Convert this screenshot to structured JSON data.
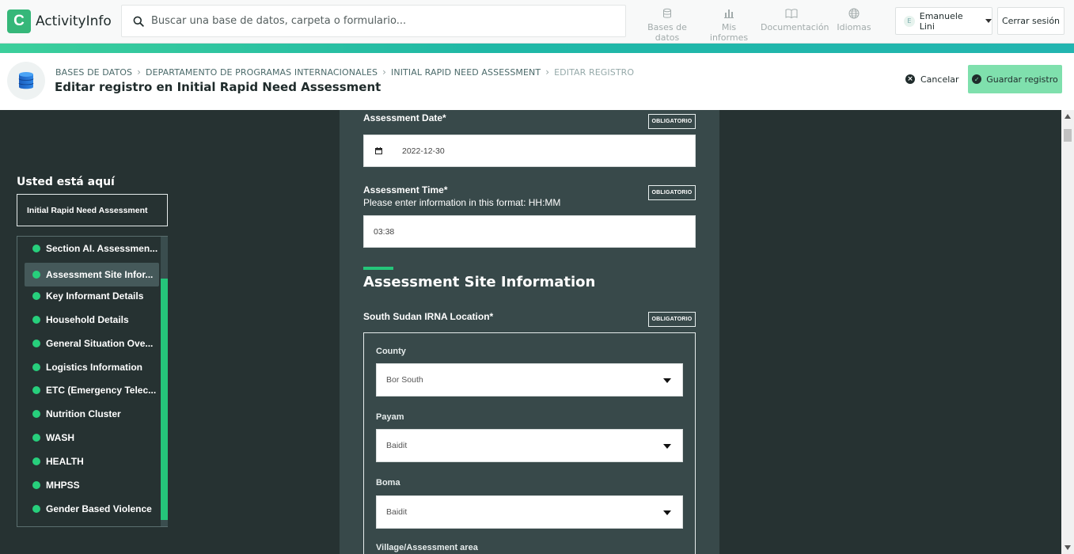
{
  "topbar": {
    "brand": {
      "logo_glyph": "C",
      "name": "ActivityInfo"
    },
    "search": {
      "placeholder": "Buscar una base de datos, carpeta o formulario..."
    },
    "nav": [
      {
        "label": "Bases de datos",
        "icon": "database-icon"
      },
      {
        "label": "Mis informes",
        "icon": "bar-chart-icon"
      },
      {
        "label": "Documentación",
        "icon": "book-icon"
      },
      {
        "label": "Idiomas",
        "icon": "globe-icon"
      }
    ],
    "user": {
      "initial": "E",
      "name": "Emanuele Lini"
    },
    "logout_label": "Cerrar sesión"
  },
  "header": {
    "breadcrumb": [
      "BASES DE DATOS",
      "DEPARTAMENTO DE PROGRAMAS INTERNACIONALES",
      "INITIAL RAPID NEED ASSESSMENT",
      "EDITAR REGISTRO"
    ],
    "title": "Editar registro en Initial Rapid Need Assessment",
    "cancel_label": "Cancelar",
    "save_label": "Guardar registro"
  },
  "sidebar": {
    "heading": "Usted está aquí",
    "current_form": "Initial Rapid Need Assessment",
    "sections": [
      {
        "label": "Section AI. Assessmen...",
        "active": false
      },
      {
        "label": "Assessment Site Infor...",
        "active": true
      },
      {
        "label": "Key Informant Details",
        "active": false
      },
      {
        "label": "Household Details",
        "active": false
      },
      {
        "label": "General Situation Ove...",
        "active": false
      },
      {
        "label": "Logistics Information",
        "active": false
      },
      {
        "label": "ETC (Emergency Telec...",
        "active": false
      },
      {
        "label": "Nutrition Cluster",
        "active": false
      },
      {
        "label": "WASH",
        "active": false
      },
      {
        "label": "HEALTH",
        "active": false
      },
      {
        "label": "MHPSS",
        "active": false
      },
      {
        "label": "Gender Based Violence",
        "active": false
      }
    ]
  },
  "form": {
    "assessment_date": {
      "label": "Assessment Date*",
      "badge": "OBLIGATORIO",
      "value": "2022-12-30"
    },
    "assessment_time": {
      "label": "Assessment Time*",
      "help": "Please enter information in this format: HH:MM",
      "badge": "OBLIGATORIO",
      "value": "03:38"
    },
    "section_title": "Assessment Site Information",
    "location": {
      "label": "South Sudan IRNA Location*",
      "badge": "OBLIGATORIO",
      "county": {
        "label": "County",
        "value": "Bor South"
      },
      "payam": {
        "label": "Payam",
        "value": "Baidit"
      },
      "boma": {
        "label": "Boma",
        "value": "Baidit"
      },
      "village": {
        "label": "Village/Assessment area"
      }
    }
  },
  "colors": {
    "accent_green": "#25c57a",
    "save_button": "#7fe0ad",
    "page_bg": "#263232",
    "form_bg": "#38494a"
  }
}
